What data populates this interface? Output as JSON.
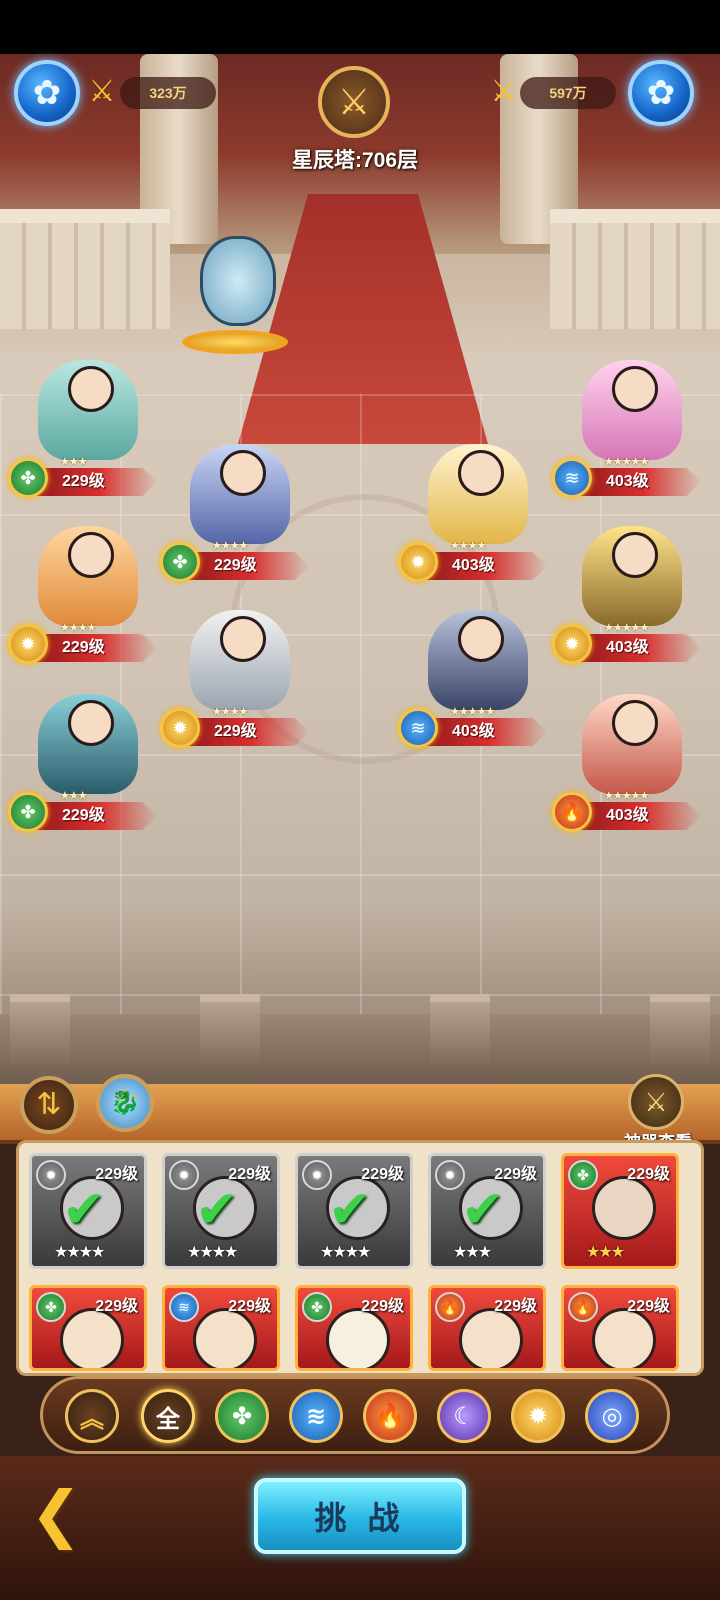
{
  "hud": {
    "left_power": "323万",
    "right_power": "597万",
    "tower_label": "星辰塔:706层"
  },
  "ally_units": [
    {
      "level": "229级",
      "element": "wood",
      "stars": "★★★"
    },
    {
      "level": "229级",
      "element": "wood",
      "stars": "★★★★"
    },
    {
      "level": "229级",
      "element": "light",
      "stars": "★★★★"
    },
    {
      "level": "229级",
      "element": "light",
      "stars": "★★★★"
    },
    {
      "level": "229级",
      "element": "wood",
      "stars": "★★★"
    }
  ],
  "enemy_units": [
    {
      "level": "403级",
      "element": "water",
      "stars": "★★★★★"
    },
    {
      "level": "403级",
      "element": "light",
      "stars": "★★★★"
    },
    {
      "level": "403级",
      "element": "light",
      "stars": "★★★★★"
    },
    {
      "level": "403级",
      "element": "water",
      "stars": "★★★★★"
    },
    {
      "level": "403级",
      "element": "fire",
      "stars": "★★★★★"
    }
  ],
  "panel": {
    "artifact_label": "神器查看",
    "challenge_label": "挑 战"
  },
  "roster": [
    {
      "level": "229级",
      "stars": "★★★★",
      "state": "used",
      "element": "light"
    },
    {
      "level": "229级",
      "stars": "★★★★",
      "state": "used",
      "element": "light"
    },
    {
      "level": "229级",
      "stars": "★★★★",
      "state": "used",
      "element": "light"
    },
    {
      "level": "229级",
      "stars": "★★★",
      "state": "used",
      "element": "light"
    },
    {
      "level": "229级",
      "stars": "★★★",
      "state": "active",
      "element": "wood"
    },
    {
      "level": "229级",
      "stars": "",
      "state": "active",
      "element": "wood"
    },
    {
      "level": "229级",
      "stars": "",
      "state": "active",
      "element": "water"
    },
    {
      "level": "229级",
      "stars": "",
      "state": "active",
      "element": "wood"
    },
    {
      "level": "229级",
      "stars": "",
      "state": "active",
      "element": "fire"
    },
    {
      "level": "229级",
      "stars": "",
      "state": "active",
      "element": "fire"
    }
  ],
  "filters": [
    {
      "id": "up",
      "label": ""
    },
    {
      "id": "all",
      "label": "全"
    },
    {
      "id": "wood",
      "label": ""
    },
    {
      "id": "water",
      "label": ""
    },
    {
      "id": "fire",
      "label": ""
    },
    {
      "id": "dark",
      "label": ""
    },
    {
      "id": "light",
      "label": ""
    },
    {
      "id": "void",
      "label": ""
    }
  ],
  "colors": {
    "challenge": "#27b7e6",
    "level_bar": "#d8302f",
    "gold": "#f4c546"
  }
}
